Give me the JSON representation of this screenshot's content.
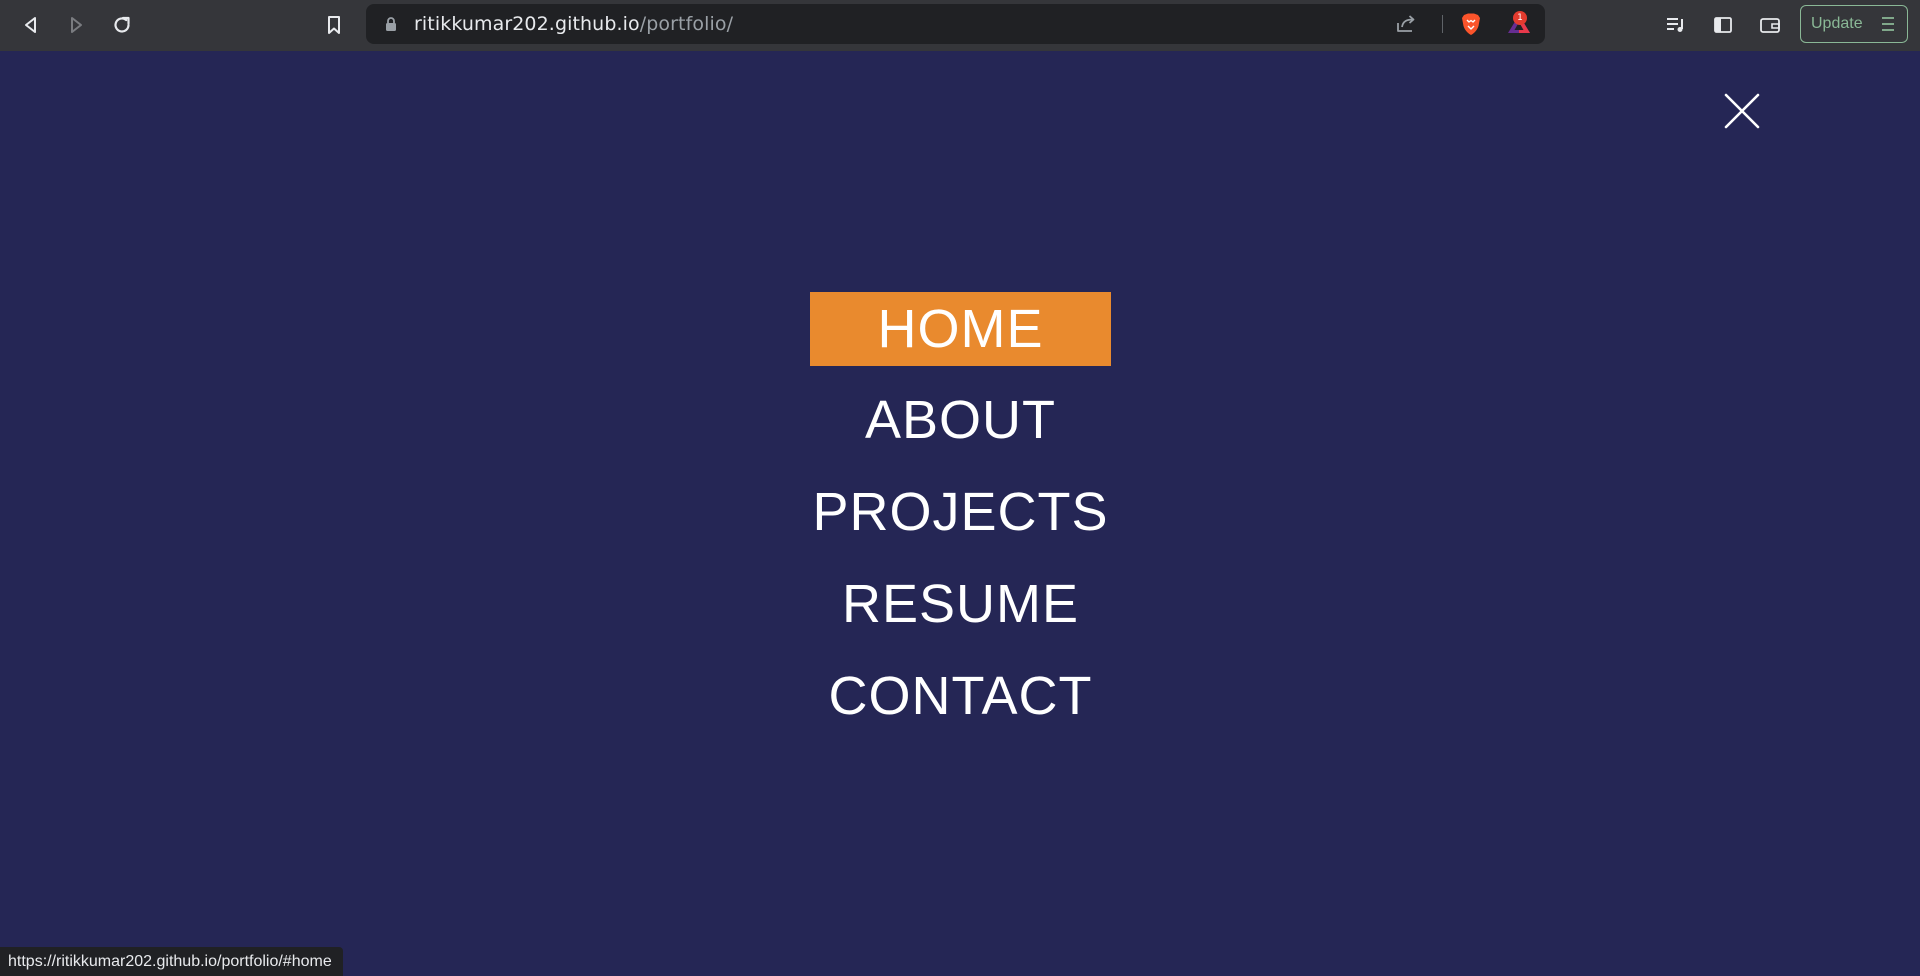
{
  "browser": {
    "url_host": "ritikkumar202.github.io",
    "url_path": "/portfolio/",
    "notification_badge": "1",
    "update_label": "Update",
    "accent_update_color": "#8ab896",
    "icons": {
      "back": "back-arrow-icon",
      "forward": "forward-arrow-icon",
      "reload": "reload-icon",
      "bookmark": "bookmark-icon",
      "lock": "lock-icon",
      "share": "share-icon",
      "brave_shields": "brave-lion-icon",
      "brave_rewards": "brave-rewards-triangle-icon",
      "media": "media-playlist-icon",
      "sidebar": "sidebar-toggle-icon",
      "wallet": "wallet-icon",
      "menu": "hamburger-menu-icon"
    }
  },
  "page": {
    "background_color": "#252655",
    "accent_color": "#e98a2e",
    "close_icon": "close-x-icon",
    "nav_items": [
      {
        "label": "HOME",
        "active": true
      },
      {
        "label": "ABOUT",
        "active": false
      },
      {
        "label": "PROJECTS",
        "active": false
      },
      {
        "label": "RESUME",
        "active": false
      },
      {
        "label": "CONTACT",
        "active": false
      }
    ]
  },
  "status_bar": {
    "link_url": "https://ritikkumar202.github.io/portfolio/#home"
  }
}
